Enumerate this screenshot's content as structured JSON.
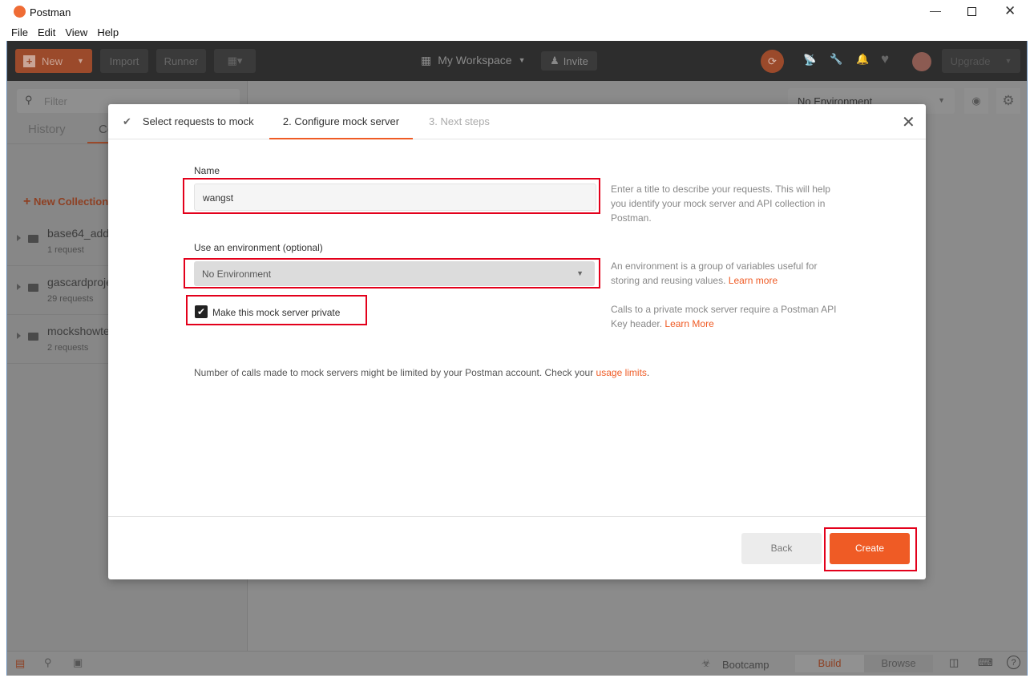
{
  "window": {
    "title": "Postman"
  },
  "menu": [
    "File",
    "Edit",
    "View",
    "Help"
  ],
  "header": {
    "new": "New",
    "import": "Import",
    "runner": "Runner",
    "workspace": "My Workspace",
    "invite": "Invite",
    "upgrade": "Upgrade"
  },
  "sidebar": {
    "filter_placeholder": "Filter",
    "tabs": [
      "History",
      "Collections"
    ],
    "new_collection": "New Collection",
    "collections": [
      {
        "name": "base64_add_",
        "count": "1 request"
      },
      {
        "name": "gascardproje",
        "count": "29 requests"
      },
      {
        "name": "mockshowte",
        "count": "2 requests"
      }
    ]
  },
  "environment": {
    "selected": "No Environment"
  },
  "footer": {
    "bootcamp": "Bootcamp",
    "build": "Build",
    "browse": "Browse"
  },
  "modal": {
    "steps": [
      "Select requests to mock",
      "2. Configure mock server",
      "3. Next steps"
    ],
    "name_label": "Name",
    "name_value": "wangst",
    "name_help": "Enter a title to describe your requests. This will help you identify your mock server and API collection in Postman.",
    "env_label": "Use an environment (optional)",
    "env_value": "No Environment",
    "env_help": "An environment is a group of variables useful for storing and reusing values.",
    "env_help_link": "Learn more",
    "private_label": "Make this mock server private",
    "private_checked": true,
    "private_help": "Calls to a private mock server require a Postman API Key header.",
    "private_help_link": "Learn More",
    "note": "Number of calls made to mock servers might be limited by your Postman account. Check your",
    "note_link": "usage limits",
    "back": "Back",
    "create": "Create"
  },
  "colors": {
    "accent": "#ef5b25"
  }
}
